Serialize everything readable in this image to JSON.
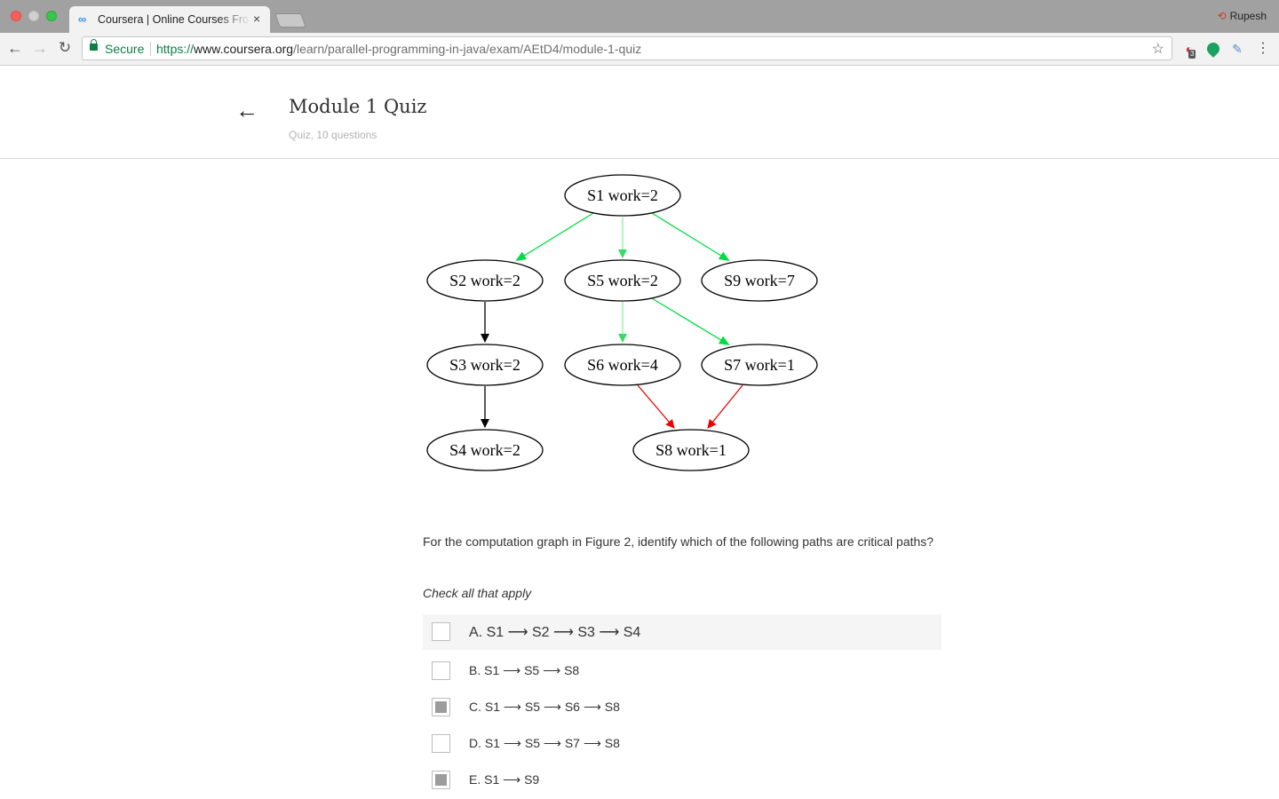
{
  "browser": {
    "tab_title": "Coursera | Online Courses From Top Universities",
    "tab_close": "×",
    "profile_name": "Rupesh",
    "secure_label": "Secure",
    "url_scheme": "https://",
    "url_host": "www.coursera.org",
    "url_path": "/learn/parallel-programming-in-java/exam/AEtD4/module-1-quiz",
    "extension_badge": "3",
    "icons": [
      "back-arrow-icon",
      "forward-arrow-icon",
      "reload-icon",
      "lock-icon",
      "star-icon",
      "extension-icon",
      "menu-icon"
    ]
  },
  "header": {
    "title": "Module 1 Quiz",
    "subtitle": "Quiz, 10 questions"
  },
  "graph": {
    "nodes": [
      {
        "id": "S1",
        "label": "S1 work=2"
      },
      {
        "id": "S2",
        "label": "S2 work=2"
      },
      {
        "id": "S5",
        "label": "S5 work=2"
      },
      {
        "id": "S9",
        "label": "S9 work=7"
      },
      {
        "id": "S3",
        "label": "S3 work=2"
      },
      {
        "id": "S6",
        "label": "S6 work=4"
      },
      {
        "id": "S7",
        "label": "S7 work=1"
      },
      {
        "id": "S4",
        "label": "S4 work=2"
      },
      {
        "id": "S8",
        "label": "S8 work=1"
      }
    ],
    "edges": [
      {
        "from": "S1",
        "to": "S2",
        "color": "#00dd44"
      },
      {
        "from": "S1",
        "to": "S5",
        "color": "#66ee88"
      },
      {
        "from": "S1",
        "to": "S9",
        "color": "#00dd44"
      },
      {
        "from": "S2",
        "to": "S3",
        "color": "#000000"
      },
      {
        "from": "S3",
        "to": "S4",
        "color": "#000000"
      },
      {
        "from": "S5",
        "to": "S6",
        "color": "#66ee88"
      },
      {
        "from": "S5",
        "to": "S7",
        "color": "#00dd44"
      },
      {
        "from": "S6",
        "to": "S8",
        "color": "#ee0000"
      },
      {
        "from": "S7",
        "to": "S8",
        "color": "#ee0000"
      }
    ]
  },
  "question": {
    "text": "For the computation graph in Figure 2, identify which of the following paths are critical paths?",
    "instruction": "Check all that apply",
    "options": [
      {
        "label": "A. S1 ⟶ S2 ⟶ S3 ⟶ S4",
        "checked": false
      },
      {
        "label": "B. S1 ⟶ S5 ⟶ S8",
        "checked": false
      },
      {
        "label": "C. S1 ⟶ S5 ⟶ S6 ⟶ S8",
        "checked": true
      },
      {
        "label": "D. S1 ⟶ S5 ⟶ S7 ⟶ S8",
        "checked": false
      },
      {
        "label": "E. S1 ⟶ S9",
        "checked": true
      }
    ]
  }
}
